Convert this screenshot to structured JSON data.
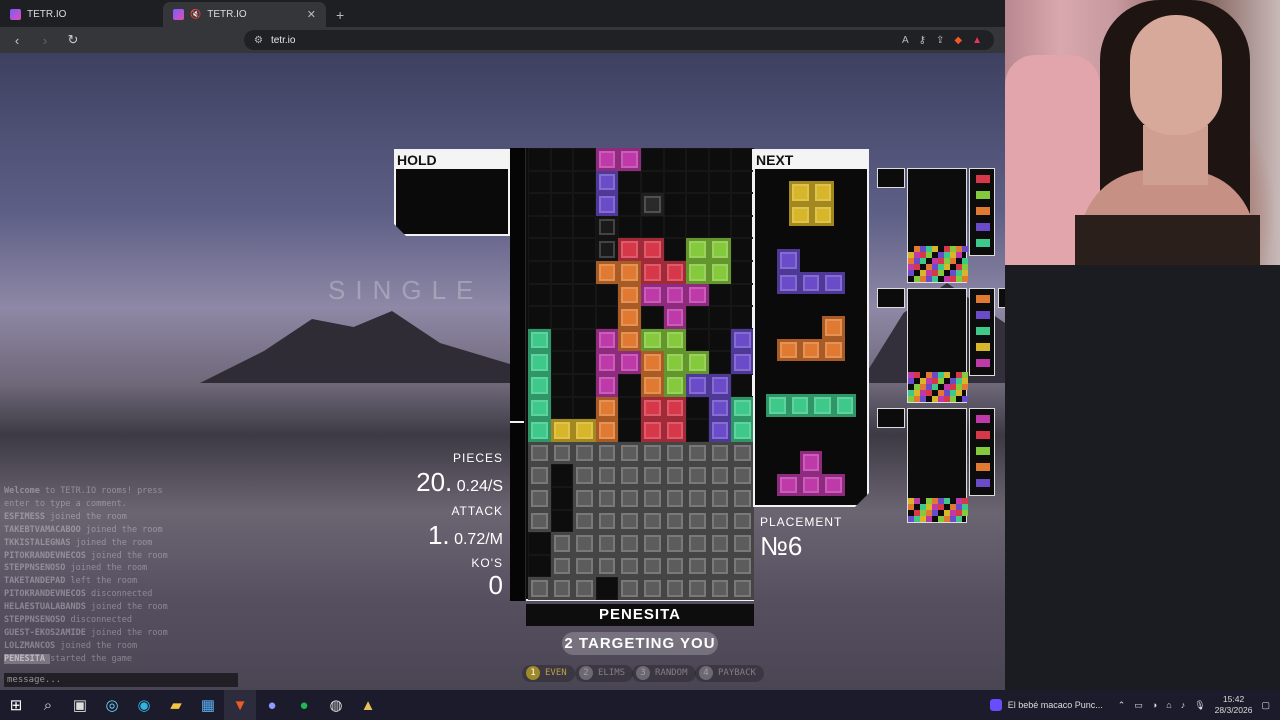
{
  "browser": {
    "tabs": [
      {
        "title": "TETR.IO"
      },
      {
        "title": "TETR.IO"
      }
    ],
    "new_tab": "+",
    "url": "tetr.io"
  },
  "game": {
    "mode_text": "SINGLE",
    "hold_label": "HOLD",
    "next_label": "NEXT",
    "stats": {
      "pieces_label": "PIECES",
      "pieces": "20.",
      "pieces_rate": "0.24/S",
      "attack_label": "ATTACK",
      "attack": "1.",
      "attack_rate": "0.72/M",
      "kos_label": "KO'S",
      "kos": "0"
    },
    "placement_label": "PLACEMENT",
    "placement": "№6",
    "username": "PENESITA",
    "targeting": "2 TARGETING YOU",
    "strategies": [
      {
        "num": "1",
        "label": "EVEN",
        "active": true
      },
      {
        "num": "2",
        "label": "ELIMS",
        "active": false
      },
      {
        "num": "3",
        "label": "RANDOM",
        "active": false
      },
      {
        "num": "4",
        "label": "PAYBACK",
        "active": false
      }
    ],
    "chat": [
      {
        "user": "Welcome",
        "text": "to TETR.IO rooms! press",
        "type": "welcome"
      },
      {
        "user": "",
        "text": "enter to type a comment.",
        "type": "welcome"
      },
      {
        "user": "ESFIMESS",
        "text": "joined the room"
      },
      {
        "user": "TAKEBTVAMACABOO",
        "text": "joined the room"
      },
      {
        "user": "TKKISTALEGNAS",
        "text": "joined the room"
      },
      {
        "user": "PITOKRANDEVNECOS",
        "text": "joined the room"
      },
      {
        "user": "STEPPNSENOSO",
        "text": "joined the room"
      },
      {
        "user": "TAKETANDEPAD",
        "text": "left the room"
      },
      {
        "user": "PITOKRANDEVNECOS",
        "text": "disconnected"
      },
      {
        "user": "HELAESTUALABANDS",
        "text": "joined the room"
      },
      {
        "user": "STEPPNSENOSO",
        "text": "disconnected"
      },
      {
        "user": "GUEST-EKOS2AMIDE",
        "text": "joined the room"
      },
      {
        "user": "LOLZMANCOS",
        "text": "joined the room"
      },
      {
        "user": "PENESITA",
        "text": "started the game",
        "highlight": true
      }
    ],
    "chat_placeholder": "message..."
  },
  "taskbar": {
    "media_title": "El bebé macaco Punc...",
    "time": "15:42",
    "date": "28/3/2026"
  },
  "colors": {
    "Z": "#d6384a",
    "S": "#85c93c",
    "L": "#e07a32",
    "J": "#6a4cc8",
    "I": "#3ec98a",
    "O": "#d8b629",
    "T": "#bf3aa9",
    "G": "#5c5c5c"
  }
}
